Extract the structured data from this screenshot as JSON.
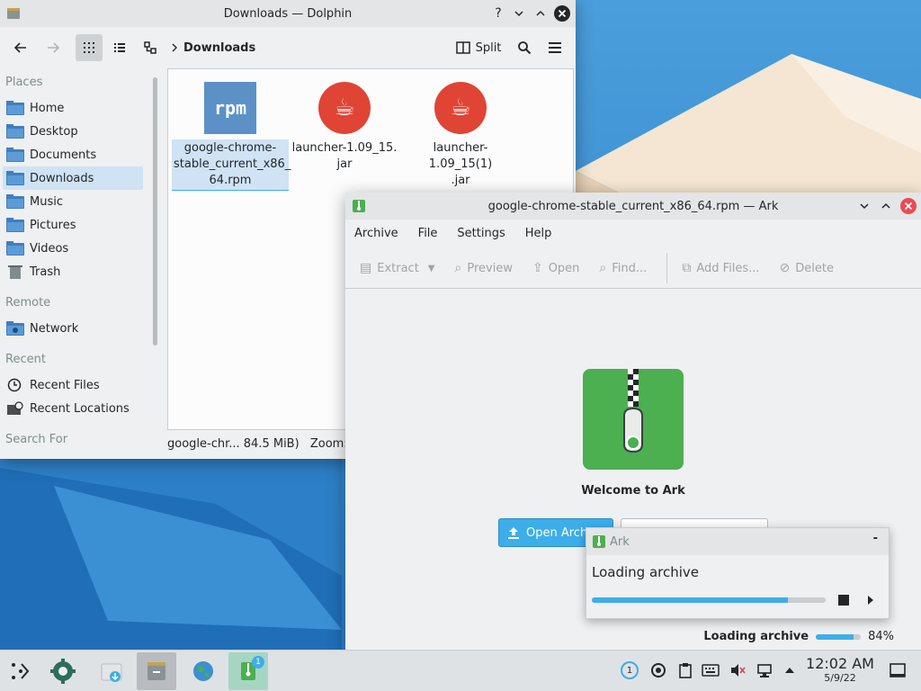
{
  "dolphin": {
    "title": "Downloads — Dolphin",
    "breadcrumb": "Downloads",
    "split_label": "Split",
    "places": {
      "heading_places": "Places",
      "heading_remote": "Remote",
      "heading_recent": "Recent",
      "heading_search": "Search For",
      "items": [
        "Home",
        "Desktop",
        "Documents",
        "Downloads",
        "Music",
        "Pictures",
        "Videos",
        "Trash"
      ],
      "remote_items": [
        "Network"
      ],
      "recent_items": [
        "Recent Files",
        "Recent Locations"
      ]
    },
    "files": [
      {
        "line1": "google-chrome-",
        "line2": "stable_current_x86_",
        "line3": "64.rpm",
        "icon_text": "rpm"
      },
      {
        "line1": "launcher-1.09_15.",
        "line2": "jar",
        "line3": ""
      },
      {
        "line1": "launcher-1.09_15(1)",
        "line2": ".jar",
        "line3": ""
      }
    ],
    "status_text": "google-chr... 84.5 MiB)",
    "zoom_label": "Zoom:"
  },
  "ark": {
    "title": "google-chrome-stable_current_x86_64.rpm — Ark",
    "menu": [
      "Archive",
      "File",
      "Settings",
      "Help"
    ],
    "toolbar": {
      "extract": "Extract",
      "preview": "Preview",
      "open": "Open",
      "find": "Find...",
      "add_files": "Add Files...",
      "delete": "Delete"
    },
    "welcome": "Welcome to Ark",
    "open_archive": "Open Archive",
    "status_label": "Loading archive",
    "status_percent": "84%",
    "progress": 0.84
  },
  "popup": {
    "app": "Ark",
    "message": "Loading archive",
    "minimize": "-",
    "progress": 0.84
  },
  "taskbar": {
    "clock_time": "12:02 AM",
    "clock_date": "5/9/22",
    "badge": "1",
    "notification_count": "1"
  },
  "colors": {
    "accent": "#3daee9",
    "selection": "#cfe3f4",
    "ark_green": "#4caf50",
    "java_red": "#e04435",
    "rpm_blue": "#5b91c6"
  }
}
